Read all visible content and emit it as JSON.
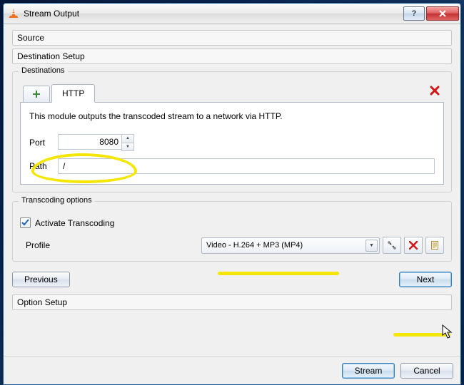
{
  "window": {
    "title": "Stream Output"
  },
  "sections": {
    "source": "Source",
    "destination_setup": "Destination Setup",
    "option_setup": "Option Setup"
  },
  "destinations": {
    "legend": "Destinations",
    "tab_http": "HTTP",
    "description": "This module outputs the transcoded stream to a network via HTTP.",
    "port_label": "Port",
    "port_value": "8080",
    "path_label": "Path",
    "path_value": "/"
  },
  "transcoding": {
    "legend": "Transcoding options",
    "activate_label": "Activate Transcoding",
    "activate_checked": true,
    "profile_label": "Profile",
    "profile_value": "Video - H.264 + MP3 (MP4)"
  },
  "buttons": {
    "previous": "Previous",
    "next": "Next",
    "stream": "Stream",
    "cancel": "Cancel",
    "help": "?"
  }
}
